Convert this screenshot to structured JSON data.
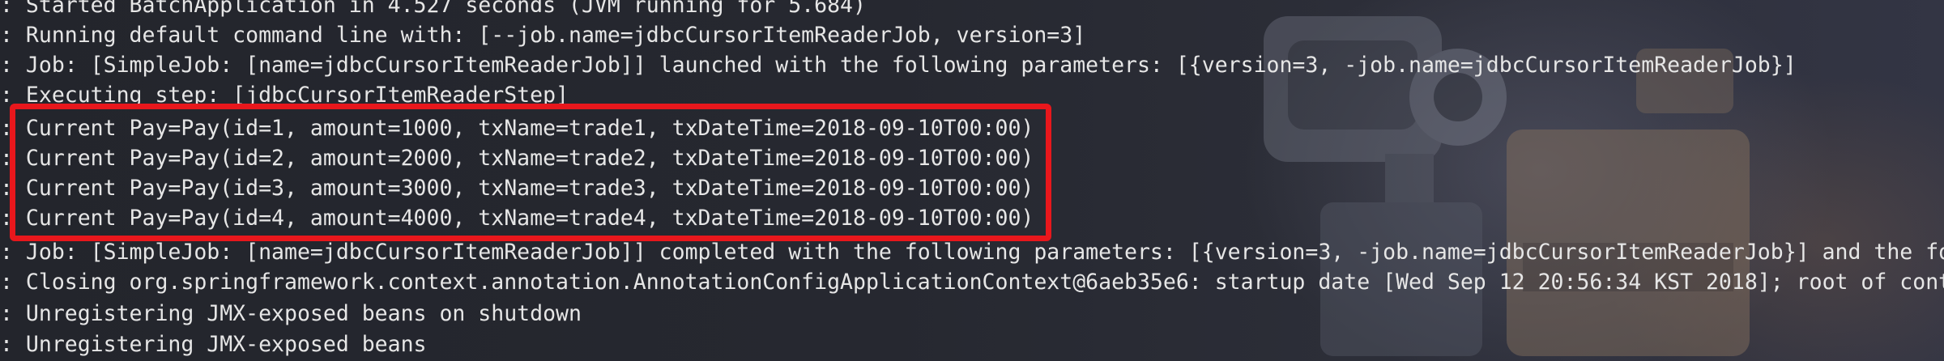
{
  "terminal": {
    "lines": [
      ": Started BatchApplication in 4.527 seconds (JVM running for 5.684)",
      ": Running default command line with: [--job.name=jdbcCursorItemReaderJob, version=3]",
      ": Job: [SimpleJob: [name=jdbcCursorItemReaderJob]] launched with the following parameters: [{version=3, -job.name=jdbcCursorItemReaderJob}]",
      ": Executing step: [jdbcCursorItemReaderStep]",
      ": Current Pay=Pay(id=1, amount=1000, txName=trade1, txDateTime=2018-09-10T00:00)",
      ": Current Pay=Pay(id=2, amount=2000, txName=trade2, txDateTime=2018-09-10T00:00)",
      ": Current Pay=Pay(id=3, amount=3000, txName=trade3, txDateTime=2018-09-10T00:00)",
      ": Current Pay=Pay(id=4, amount=4000, txName=trade4, txDateTime=2018-09-10T00:00)",
      ": Job: [SimpleJob: [name=jdbcCursorItemReaderJob]] completed with the following parameters: [{version=3, -job.name=jdbcCursorItemReaderJob}] and the fo",
      ": Closing org.springframework.context.annotation.AnnotationConfigApplicationContext@6aeb35e6: startup date [Wed Sep 12 20:56:34 KST 2018]; root of conte",
      ": Unregistering JMX-exposed beans on shutdown",
      ": Unregistering JMX-exposed beans"
    ]
  },
  "colors": {
    "text": "#e6e6e6",
    "highlight_border": "#e8171c",
    "background": "#262830"
  }
}
